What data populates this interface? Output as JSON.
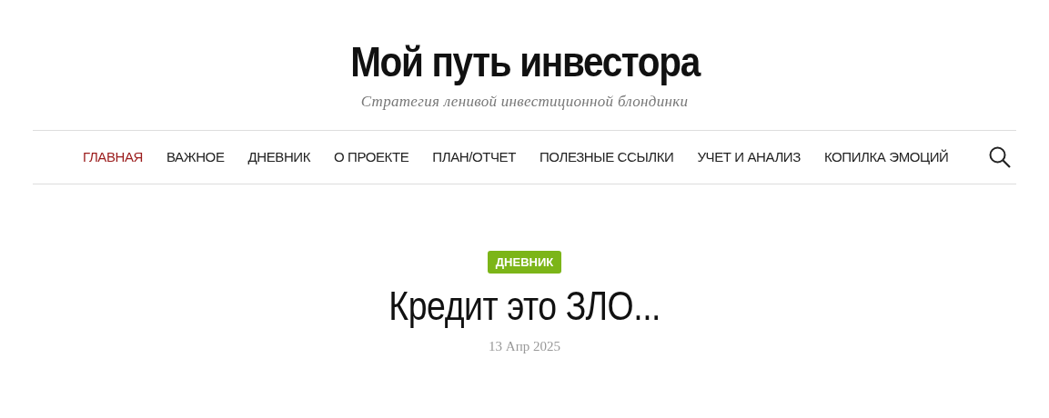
{
  "site": {
    "title": "Мой путь инвестора",
    "tagline": "Стратегия ленивой инвестиционной блондинки"
  },
  "nav": {
    "items": [
      {
        "label": "ГЛАВНАЯ",
        "selected": true
      },
      {
        "label": "ВАЖНОЕ",
        "selected": false
      },
      {
        "label": "ДНЕВНИК",
        "selected": false
      },
      {
        "label": "О ПРОЕКТЕ",
        "selected": false
      },
      {
        "label": "ПЛАН/ОТЧЕТ",
        "selected": false
      },
      {
        "label": "ПОЛЕЗНЫЕ ССЫЛКИ",
        "selected": false
      },
      {
        "label": "УЧЕТ И АНАЛИЗ",
        "selected": false
      },
      {
        "label": "КОПИЛКА ЭМОЦИЙ",
        "selected": false
      }
    ]
  },
  "post": {
    "category": "ДНЕВНИК",
    "title": "Кредит это ЗЛО...",
    "date": "13 Апр 2025"
  }
}
